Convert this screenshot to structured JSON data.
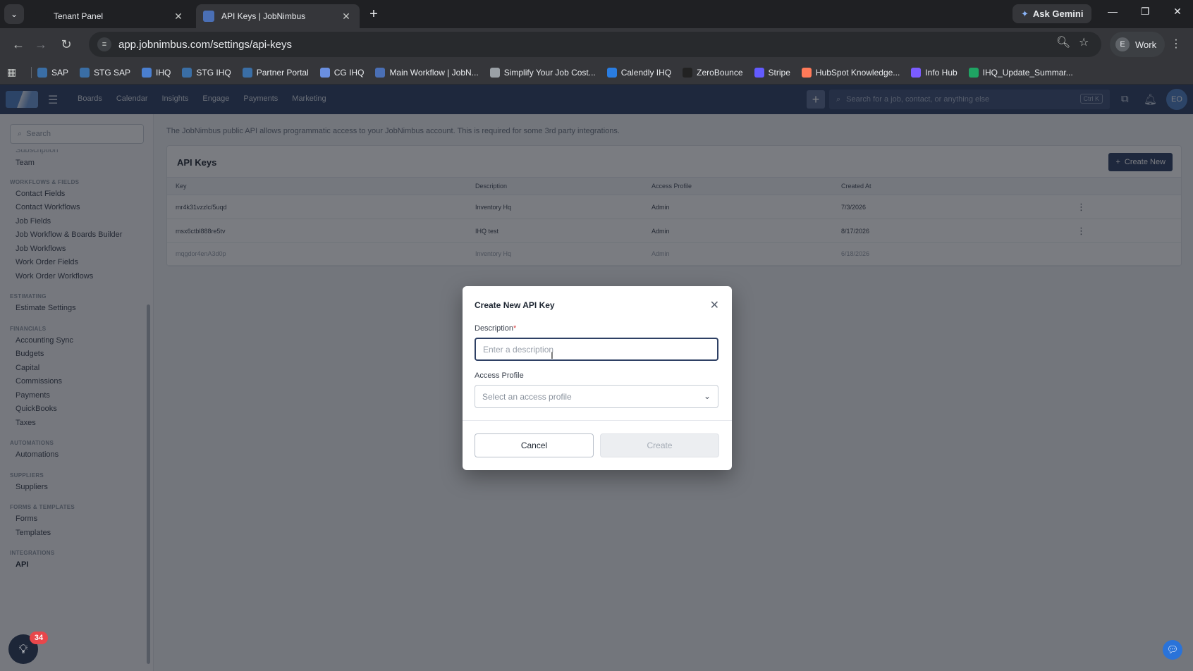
{
  "browser": {
    "tabs": [
      {
        "title": "Tenant Panel",
        "active": false
      },
      {
        "title": "API Keys | JobNimbus",
        "active": true
      }
    ],
    "ask_gemini": "Ask Gemini",
    "url": "app.jobnimbus.com/settings/api-keys",
    "profile_initial": "E",
    "profile_name": "Work",
    "bookmarks": [
      {
        "label": "SAP",
        "color": "#3a6ea5"
      },
      {
        "label": "STG SAP",
        "color": "#3a6ea5"
      },
      {
        "label": "IHQ",
        "color": "#4a7fd0"
      },
      {
        "label": "STG IHQ",
        "color": "#3a6ea5"
      },
      {
        "label": "Partner Portal",
        "color": "#3a6ea5"
      },
      {
        "label": "CG IHQ",
        "color": "#6a8fe0"
      },
      {
        "label": "Main Workflow | JobN...",
        "color": "#4a6fb5"
      },
      {
        "label": "Simplify Your Job Cost...",
        "color": "#9aa0a6"
      },
      {
        "label": "Calendly IHQ",
        "color": "#2a7de1"
      },
      {
        "label": "ZeroBounce",
        "color": "#222222"
      },
      {
        "label": "Stripe",
        "color": "#635bff"
      },
      {
        "label": "HubSpot Knowledge...",
        "color": "#ff7a59"
      },
      {
        "label": "Info Hub",
        "color": "#7b5cff"
      },
      {
        "label": "IHQ_Update_Summar...",
        "color": "#1fa463"
      }
    ]
  },
  "app": {
    "nav": [
      "Boards",
      "Calendar",
      "Insights",
      "Engage",
      "Payments",
      "Marketing"
    ],
    "search_placeholder": "Search for a job, contact, or anything else",
    "search_shortcut": "Ctrl K",
    "avatar": "EO",
    "sidebar": {
      "search_placeholder": "Search",
      "cut_item": "Subscription",
      "sections": [
        {
          "title": "",
          "items": [
            "Team"
          ]
        },
        {
          "title": "WORKFLOWS & FIELDS",
          "items": [
            "Contact Fields",
            "Contact Workflows",
            "Job Fields",
            "Job Workflow & Boards Builder",
            "Job Workflows",
            "Work Order Fields",
            "Work Order Workflows"
          ]
        },
        {
          "title": "ESTIMATING",
          "items": [
            "Estimate Settings"
          ]
        },
        {
          "title": "FINANCIALS",
          "items": [
            "Accounting Sync",
            "Budgets",
            "Capital",
            "Commissions",
            "Payments",
            "QuickBooks",
            "Taxes"
          ]
        },
        {
          "title": "AUTOMATIONS",
          "items": [
            "Automations"
          ]
        },
        {
          "title": "SUPPLIERS",
          "items": [
            "Suppliers"
          ]
        },
        {
          "title": "FORMS & TEMPLATES",
          "items": [
            "Forms",
            "Templates"
          ]
        },
        {
          "title": "INTEGRATIONS",
          "items": [
            "API"
          ]
        }
      ]
    },
    "intro": "The JobNimbus public API allows programmatic access to your JobNimbus account. This is required for some 3rd party integrations.",
    "card_title": "API Keys",
    "create_new": "Create New",
    "columns": [
      "Key",
      "Description",
      "Access Profile",
      "Created At"
    ],
    "rows": [
      {
        "key": "mr4k31vzzlc/5uqd",
        "description": "Inventory Hq",
        "profile": "Admin",
        "created": "7/3/2026"
      },
      {
        "key": "msx6ctbl888re5tv",
        "description": "IHQ test",
        "profile": "Admin",
        "created": "8/17/2026"
      },
      {
        "key": "mqgdor4enA3d0p",
        "description": "Inventory Hq",
        "profile": "Admin",
        "created": "6/18/2026"
      }
    ],
    "notification_count": "34"
  },
  "modal": {
    "title": "Create New API Key",
    "description_label": "Description",
    "description_required": "*",
    "description_placeholder": "Enter a description",
    "description_value": "",
    "access_profile_label": "Access Profile",
    "access_profile_placeholder": "Select an access profile",
    "cancel": "Cancel",
    "create": "Create"
  }
}
